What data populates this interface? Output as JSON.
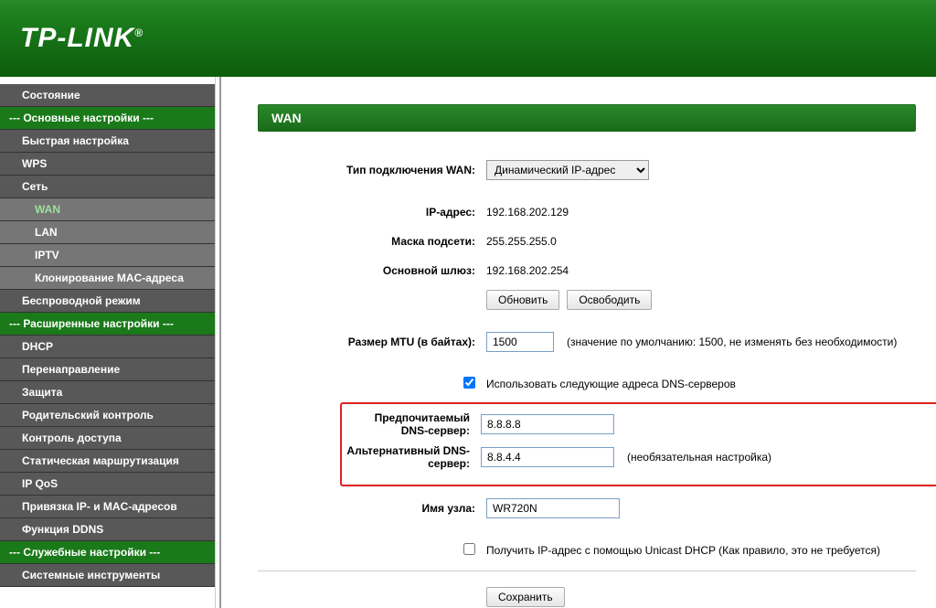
{
  "brand": "TP-LINK",
  "sidebar": {
    "status": "Состояние",
    "basic_heading": "--- Основные настройки ---",
    "quick_setup": "Быстрая настройка",
    "wps": "WPS",
    "network": "Сеть",
    "wan": "WAN",
    "lan": "LAN",
    "iptv": "IPTV",
    "mac_clone": "Клонирование MAC-адреса",
    "wireless": "Беспроводной режим",
    "adv_heading": "--- Расширенные настройки ---",
    "dhcp": "DHCP",
    "forwarding": "Перенаправление",
    "security": "Защита",
    "parental": "Родительский контроль",
    "access": "Контроль доступа",
    "routing": "Статическая маршрутизация",
    "ipqos": "IP QoS",
    "binding": "Привязка IP- и MAC-адресов",
    "ddns": "Функция DDNS",
    "svc_heading": "--- Служебные настройки ---",
    "systools": "Системные инструменты"
  },
  "page": {
    "title": "WAN",
    "conn_type_label": "Тип подключения WAN:",
    "conn_type_value": "Динамический IP-адрес",
    "ip_label": "IP-адрес:",
    "ip_value": "192.168.202.129",
    "mask_label": "Маска подсети:",
    "mask_value": "255.255.255.0",
    "gw_label": "Основной шлюз:",
    "gw_value": "192.168.202.254",
    "renew_btn": "Обновить",
    "release_btn": "Освободить",
    "mtu_label": "Размер MTU (в байтах):",
    "mtu_value": "1500",
    "mtu_hint": "(значение по умолчанию: 1500, не изменять без необходимости)",
    "use_dns_label": "Использовать следующие адреса DNS-серверов",
    "dns1_label": "Предпочитаемый DNS-сервер:",
    "dns1_value": "8.8.8.8",
    "dns2_label": "Альтернативный DNS-сервер:",
    "dns2_value": "8.8.4.4",
    "dns2_hint": "(необязательная настройка)",
    "host_label": "Имя узла:",
    "host_value": "WR720N",
    "unicast_label": "Получить IP-адрес с помощью Unicast DHCP (Как правило, это не требуется)",
    "save_btn": "Сохранить"
  }
}
